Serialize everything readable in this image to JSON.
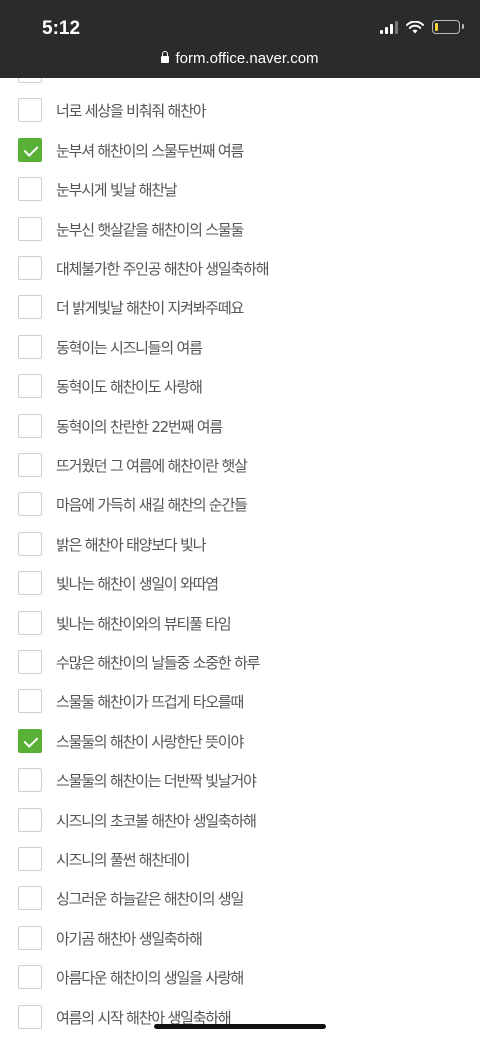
{
  "status_bar": {
    "time": "5:12"
  },
  "browser": {
    "url": "form.office.naver.com"
  },
  "options": [
    {
      "label": "",
      "checked": false
    },
    {
      "label": "너로 세상을 비춰줘 해찬아",
      "checked": false
    },
    {
      "label": "눈부셔 해찬이의 스물두번째 여름",
      "checked": true
    },
    {
      "label": "눈부시게 빛날 해찬날",
      "checked": false
    },
    {
      "label": "눈부신 햇살같을 해찬이의 스물둘",
      "checked": false
    },
    {
      "label": "대체불가한 주인공 해찬아 생일축하해",
      "checked": false
    },
    {
      "label": "더 밝게빛날 해찬이 지켜봐주떼요",
      "checked": false
    },
    {
      "label": "동혁이는 시즈니들의 여름",
      "checked": false
    },
    {
      "label": "동혁이도 해찬이도 사랑해",
      "checked": false
    },
    {
      "label": "동혁이의 찬란한 22번째 여름",
      "checked": false
    },
    {
      "label": "뜨거웠던 그 여름에 해찬이란 햇살",
      "checked": false
    },
    {
      "label": "마음에 가득히 새길 해찬의 순간들",
      "checked": false
    },
    {
      "label": "밝은 해찬아 태양보다 빛나",
      "checked": false
    },
    {
      "label": "빛나는 해찬이 생일이 와따염",
      "checked": false
    },
    {
      "label": "빛나는 해찬이와의 뷰티풀 타임",
      "checked": false
    },
    {
      "label": "수많은 해찬이의 날들중 소중한 하루",
      "checked": false
    },
    {
      "label": "스물둘 해찬이가 뜨겁게 타오를때",
      "checked": false
    },
    {
      "label": "스물둘의 해찬이 사랑한단 뜻이야",
      "checked": true
    },
    {
      "label": "스물둘의 해찬이는 더반짝 빛날거야",
      "checked": false
    },
    {
      "label": "시즈니의 초코볼 해찬아 생일축하해",
      "checked": false
    },
    {
      "label": "시즈니의 풀썬 해찬데이",
      "checked": false
    },
    {
      "label": "싱그러운 하늘같은 해찬이의 생일",
      "checked": false
    },
    {
      "label": "아기곰 해찬아 생일축하해",
      "checked": false
    },
    {
      "label": "아름다운 해찬이의 생일을 사랑해",
      "checked": false
    },
    {
      "label": "여름의 시작 해찬아 생일축하해",
      "checked": false
    }
  ]
}
